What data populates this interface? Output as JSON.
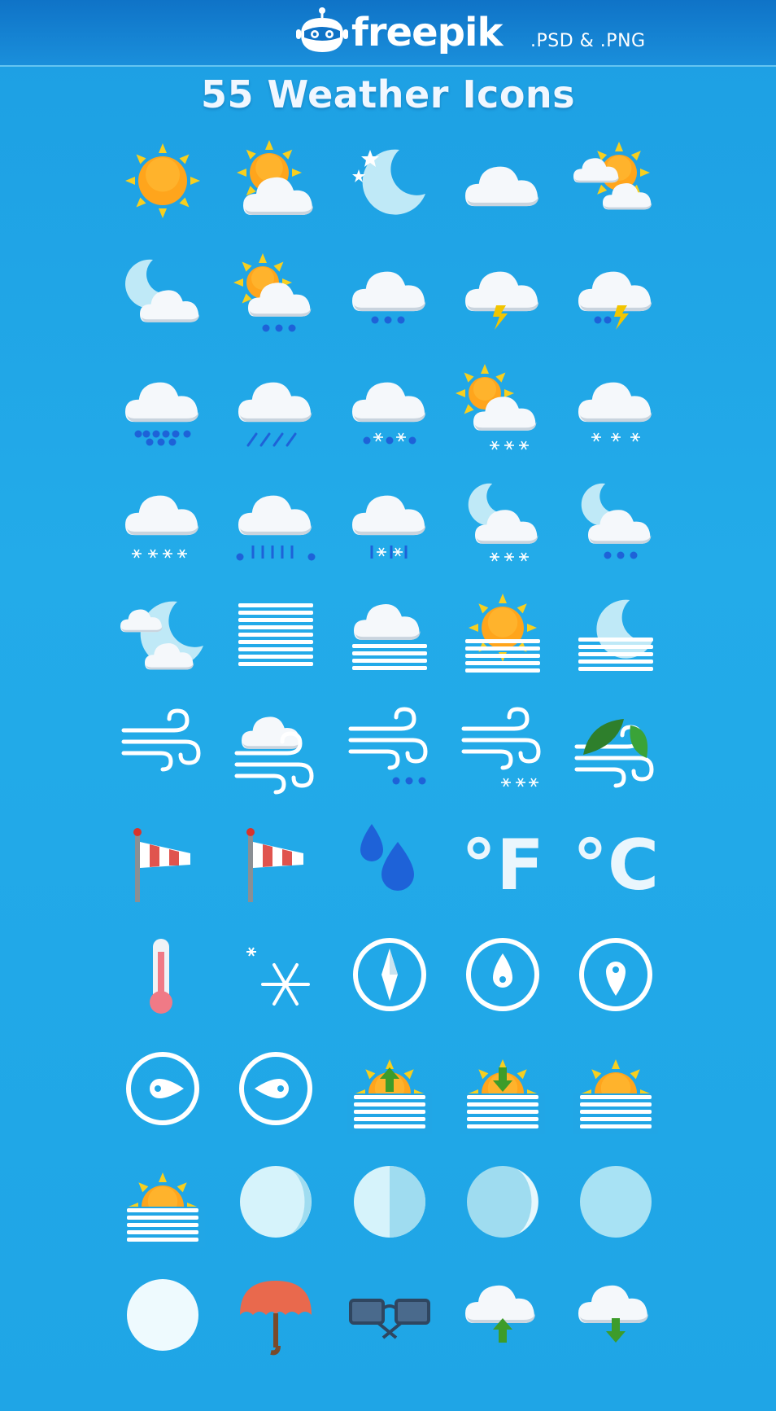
{
  "header": {
    "brand": "freepik",
    "formats": ".PSD & .PNG",
    "logo_icon": "robot-mascot-icon"
  },
  "title": "55 Weather Icons",
  "colors": {
    "background": "#21a6e6",
    "header_bar": "#0f73c7",
    "cloud": "#f5f8fb",
    "sun": "#ffa51c",
    "sun_rays": "#f7cf1f",
    "moon": "#bfe9f7",
    "rain": "#1e62d8",
    "lightning": "#f2c500",
    "leaf": "#2e7f2c",
    "windsock": "#e0544e",
    "arrow": "#3d9c2a",
    "umbrella": "#e9694d"
  },
  "icons": [
    {
      "name": "sun-icon"
    },
    {
      "name": "partly-cloudy-day-icon"
    },
    {
      "name": "clear-night-icon"
    },
    {
      "name": "cloud-icon"
    },
    {
      "name": "sun-clouds-icon"
    },
    {
      "name": "cloudy-night-icon"
    },
    {
      "name": "sun-cloud-rain-icon"
    },
    {
      "name": "cloud-rain-icon"
    },
    {
      "name": "cloud-lightning-icon"
    },
    {
      "name": "cloud-rain-lightning-icon"
    },
    {
      "name": "cloud-heavy-rain-icon"
    },
    {
      "name": "cloud-slanted-rain-icon"
    },
    {
      "name": "cloud-sleet-icon"
    },
    {
      "name": "sun-cloud-snow-icon"
    },
    {
      "name": "cloud-snow-icon"
    },
    {
      "name": "cloud-heavy-snow-icon"
    },
    {
      "name": "cloud-hail-icon"
    },
    {
      "name": "cloud-hail-snow-icon"
    },
    {
      "name": "night-cloud-snow-icon"
    },
    {
      "name": "night-cloud-rain-icon"
    },
    {
      "name": "moon-clouds-icon"
    },
    {
      "name": "fog-icon"
    },
    {
      "name": "cloud-fog-icon"
    },
    {
      "name": "sun-fog-icon"
    },
    {
      "name": "moon-fog-icon"
    },
    {
      "name": "wind-icon"
    },
    {
      "name": "cloud-wind-icon"
    },
    {
      "name": "wind-rain-icon"
    },
    {
      "name": "wind-snow-icon"
    },
    {
      "name": "wind-leaves-icon"
    },
    {
      "name": "windsock-icon"
    },
    {
      "name": "windsock-strong-icon"
    },
    {
      "name": "raindrops-icon"
    },
    {
      "name": "fahrenheit-icon",
      "text": "°F"
    },
    {
      "name": "celsius-icon",
      "text": "°C"
    },
    {
      "name": "thermometer-icon"
    },
    {
      "name": "snowflakes-icon"
    },
    {
      "name": "compass-icon"
    },
    {
      "name": "compass-north-icon"
    },
    {
      "name": "compass-south-icon"
    },
    {
      "name": "compass-east-icon"
    },
    {
      "name": "compass-west-icon"
    },
    {
      "name": "sunrise-icon"
    },
    {
      "name": "sunset-icon"
    },
    {
      "name": "horizon-sun-icon"
    },
    {
      "name": "horizon-sun-small-icon"
    },
    {
      "name": "moon-phase-waxing-gibbous-icon"
    },
    {
      "name": "moon-phase-half-icon"
    },
    {
      "name": "moon-phase-crescent-icon"
    },
    {
      "name": "moon-phase-new-icon"
    },
    {
      "name": "full-moon-icon"
    },
    {
      "name": "umbrella-icon"
    },
    {
      "name": "sunglasses-icon"
    },
    {
      "name": "cloud-upload-icon"
    },
    {
      "name": "cloud-download-icon"
    }
  ]
}
